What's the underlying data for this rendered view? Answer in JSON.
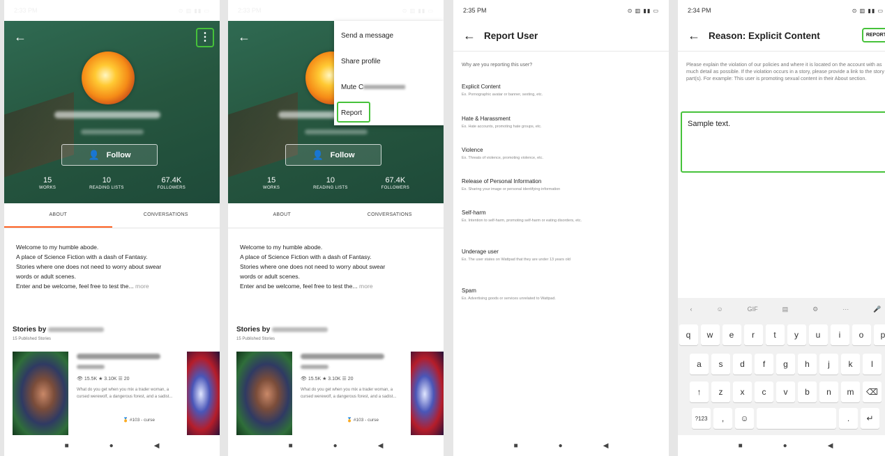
{
  "screens": [
    {
      "status_time": "2:33 PM",
      "status_icons": "⊙ ▥ ▮▮ ▭"
    },
    {
      "status_time": "2:33 PM",
      "status_icons": "⊙ ▥ ▮▮ ▭"
    },
    {
      "status_time": "2:35 PM",
      "status_icons": "⊙ ▥ ▮▮ ▭"
    },
    {
      "status_time": "2:34 PM",
      "status_icons": "⊙ ▥ ▮▮ ▭"
    }
  ],
  "profile": {
    "follow_label": "Follow",
    "stats": [
      {
        "value": "15",
        "label": "WORKS"
      },
      {
        "value": "10",
        "label": "READING LISTS"
      },
      {
        "value": "67.4K",
        "label": "FOLLOWERS"
      }
    ],
    "tabs": [
      "ABOUT",
      "CONVERSATIONS"
    ],
    "about_lines": [
      "Welcome to my humble abode.",
      "A place of Science Fiction with a dash of Fantasy.",
      "Stories where one does not need to worry about swear",
      "words or adult scenes.",
      "Enter and be welcome, feel free to test the..."
    ],
    "more_label": "more",
    "stories_by": "Stories by",
    "published": "15 Published Stories",
    "story_meta": "👁 15.5K  ★ 3.10K  ☰ 20",
    "story_desc": "What do you get when you mix a trader woman, a cursed werewolf, a dangerous forest, and a sadist...",
    "story_rank": "#103 - curse"
  },
  "menu": {
    "items": [
      "Send a message",
      "Share profile",
      "Mute C",
      "Report"
    ]
  },
  "report_user": {
    "title": "Report User",
    "question": "Why are you reporting this user?",
    "options": [
      {
        "title": "Explicit Content",
        "sub": "Ex. Pornographic avatar or banner, sexting, etc."
      },
      {
        "title": "Hate & Harassment",
        "sub": "Ex. Hate accounts, promoting hate groups, etc."
      },
      {
        "title": "Violence",
        "sub": "Ex. Threats of violence, promoting violence, etc."
      },
      {
        "title": "Release of Personal Information",
        "sub": "Ex. Sharing your image or personal identifying information"
      },
      {
        "title": "Self-harm",
        "sub": "Ex. Intention to self-harm, promoting self-harm or eating disorders, etc."
      },
      {
        "title": "Underage user",
        "sub": "Ex. The user states on Wattpad that they are under 13 years old"
      },
      {
        "title": "Spam",
        "sub": "Ex. Advertising goods or services unrelated to Wattpad."
      }
    ]
  },
  "reason": {
    "title": "Reason: Explicit Content",
    "report_button": "REPORT",
    "explanation": "Please explain the violation of our policies and where it is located on the account with as much detail as possible. If the violation occurs in a story, please provide a link to the story part(s). For example: This user is promoting sexual content in their About section.",
    "input_value": "Sample text."
  },
  "keyboard": {
    "toolbar": [
      "‹",
      "☺",
      "GIF",
      "▤",
      "⚙",
      "···",
      "🎤"
    ],
    "row1": [
      "q",
      "w",
      "e",
      "r",
      "t",
      "y",
      "u",
      "i",
      "o",
      "p"
    ],
    "row2": [
      "a",
      "s",
      "d",
      "f",
      "g",
      "h",
      "j",
      "k",
      "l"
    ],
    "row3": [
      "↑",
      "z",
      "x",
      "c",
      "v",
      "b",
      "n",
      "m",
      "⌫"
    ],
    "row4": [
      "?123",
      ",",
      "☺",
      " ",
      ".",
      "↵"
    ]
  },
  "navbar": [
    "■",
    "●",
    "◀"
  ]
}
